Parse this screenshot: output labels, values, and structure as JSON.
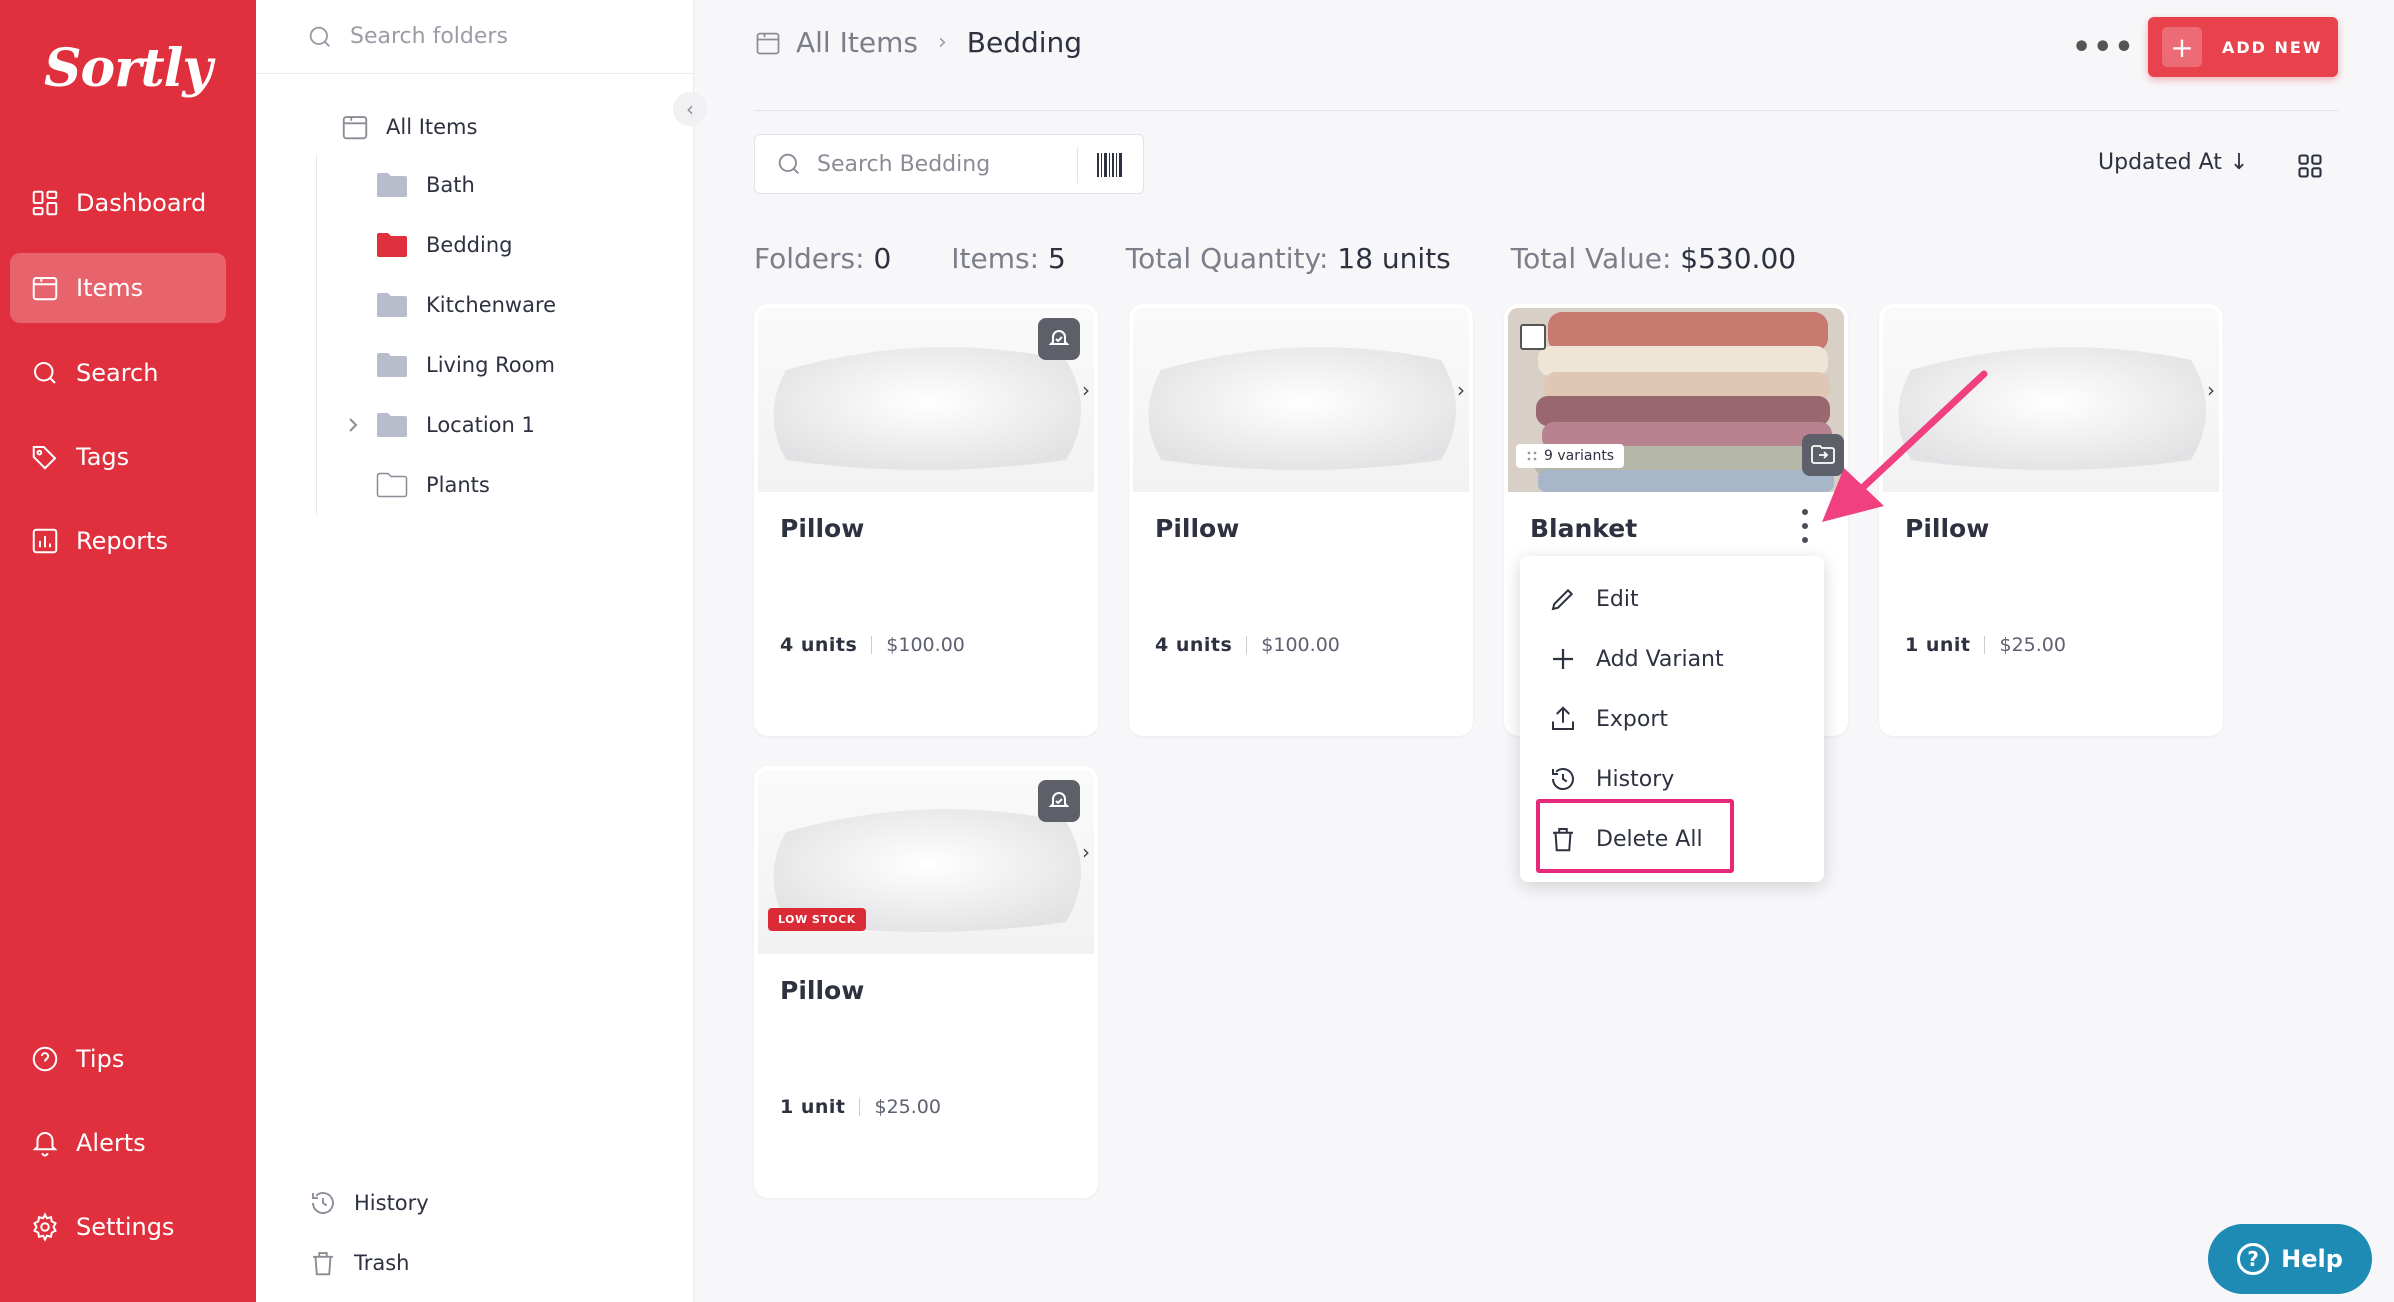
{
  "nav": {
    "logo": "Sortly",
    "items": [
      {
        "label": "Dashboard",
        "icon": "dashboard-icon"
      },
      {
        "label": "Items",
        "icon": "items-icon",
        "active": true
      },
      {
        "label": "Search",
        "icon": "search-icon"
      },
      {
        "label": "Tags",
        "icon": "tags-icon"
      },
      {
        "label": "Reports",
        "icon": "reports-icon"
      }
    ],
    "bottom": [
      {
        "label": "Tips",
        "icon": "tips-icon"
      },
      {
        "label": "Alerts",
        "icon": "bell-icon"
      },
      {
        "label": "Settings",
        "icon": "gear-icon"
      }
    ]
  },
  "folders": {
    "search_placeholder": "Search folders",
    "root": "All Items",
    "children": [
      "Bath",
      "Bedding",
      "Kitchenware",
      "Living Room",
      "Location 1",
      "Plants"
    ],
    "selected": "Bedding",
    "history": "History",
    "trash": "Trash"
  },
  "header": {
    "breadcrumb_root": "All Items",
    "breadcrumb_sep": "›",
    "breadcrumb_current": "Bedding",
    "more": "•••",
    "add_new": "ADD NEW",
    "add_plus": "+"
  },
  "toolbar": {
    "search_placeholder": "Search Bedding",
    "sort_label": "Updated At",
    "sort_arrow": "↓"
  },
  "stats": {
    "folders_label": "Folders:",
    "folders_value": "0",
    "items_label": "Items:",
    "items_value": "5",
    "qty_label": "Total Quantity:",
    "qty_value": "18 units",
    "value_label": "Total Value:",
    "value_value": "$530.00"
  },
  "cards": [
    {
      "title": "Pillow",
      "qty": "4 units",
      "price": "$100.00"
    },
    {
      "title": "Pillow",
      "qty": "4 units",
      "price": "$100.00"
    },
    {
      "title": "Blanket",
      "variants": "9 variants"
    },
    {
      "title": "Pillow",
      "qty": "1 unit",
      "price": "$25.00"
    },
    {
      "title": "Pillow",
      "qty": "1 unit",
      "price": "$25.00",
      "badge": "LOW STOCK"
    }
  ],
  "menu": {
    "items": [
      "Edit",
      "Add Variant",
      "Export",
      "History",
      "Delete All"
    ]
  },
  "help": {
    "label": "Help",
    "q": "?"
  },
  "colors": {
    "brand": "#e0303d",
    "highlight": "#e6287a",
    "arrow": "#f0407f",
    "help": "#1e8bb5",
    "folder": "#b8bdcc",
    "folder_active": "#e0303d"
  }
}
